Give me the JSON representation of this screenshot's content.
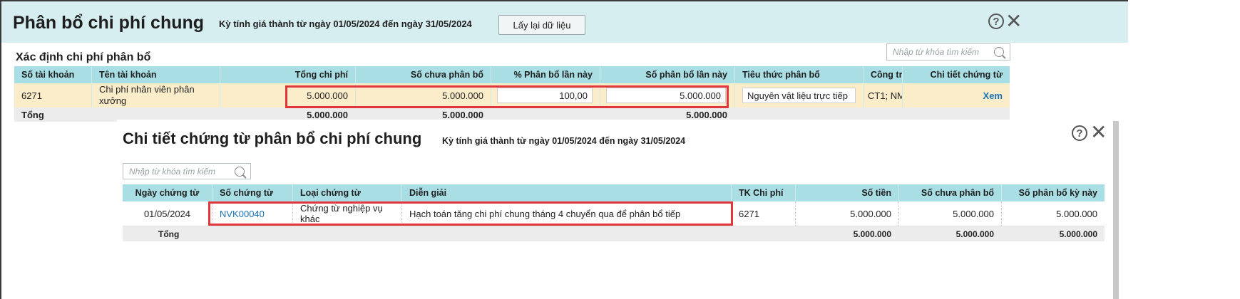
{
  "dialog1": {
    "title": "Phân bổ chi phí chung",
    "period": "Kỳ tính giá thành từ ngày 01/05/2024 đến ngày 31/05/2024",
    "reload_label": "Lấy lại dữ liệu",
    "help_icon": "?",
    "close_icon": "✕",
    "section_title": "Xác định chi phí phân bổ",
    "search_placeholder": "Nhập từ khóa tìm kiếm",
    "columns": [
      "Số tài khoản",
      "Tên tài khoản",
      "Tổng chi phí",
      "Số chưa phân bổ",
      "% Phân bổ lần này",
      "Số phân bổ lần này",
      "Tiêu thức phân bổ",
      "Công trì",
      "Chi tiết chứng từ"
    ],
    "row": {
      "account_no": "6271",
      "account_name_line1": "Chi phí nhân viên phân",
      "account_name_line2": "xưởng",
      "total_cost": "5.000.000",
      "unallocated": "5.000.000",
      "percent": "100,00",
      "allocated": "5.000.000",
      "criteria": "Nguyên vật liệu trực tiếp",
      "project": "CT1; NM",
      "detail_link": "Xem"
    },
    "total": {
      "label": "Tổng",
      "total_cost": "5.000.000",
      "unallocated": "5.000.000",
      "allocated": "5.000.000"
    }
  },
  "dialog2": {
    "title": "Chi tiết chứng từ phân bổ chi phí chung",
    "period": "Kỳ tính giá thành từ ngày 01/05/2024 đến ngày 31/05/2024",
    "help_icon": "?",
    "close_icon": "✕",
    "search_placeholder": "Nhập từ khóa tìm kiếm",
    "columns": [
      "Ngày chứng từ",
      "Số chứng từ",
      "Loại chứng từ",
      "Diễn giải",
      "TK Chi phí",
      "Số tiền",
      "Số chưa phân bổ",
      "Số phân bổ kỳ này"
    ],
    "row": {
      "date": "01/05/2024",
      "voucher_no": "NVK00040",
      "voucher_type_line1": "Chứng từ nghiệp vụ",
      "voucher_type_line2": "khác",
      "description": "Hạch toán tăng chi phí chung tháng 4 chuyển qua để phân bổ tiếp",
      "expense_account": "6271",
      "amount": "5.000.000",
      "unallocated": "5.000.000",
      "allocated_period": "5.000.000"
    },
    "total": {
      "label": "Tổng",
      "amount": "5.000.000",
      "unallocated": "5.000.000",
      "allocated_period": "5.000.000"
    }
  },
  "colors": {
    "header_bg": "#d6eef0",
    "table_header_bg": "#a8dee4",
    "selected_row_bg": "#fbedc9",
    "highlight_border": "#e0363c",
    "link": "#1a73b8"
  }
}
